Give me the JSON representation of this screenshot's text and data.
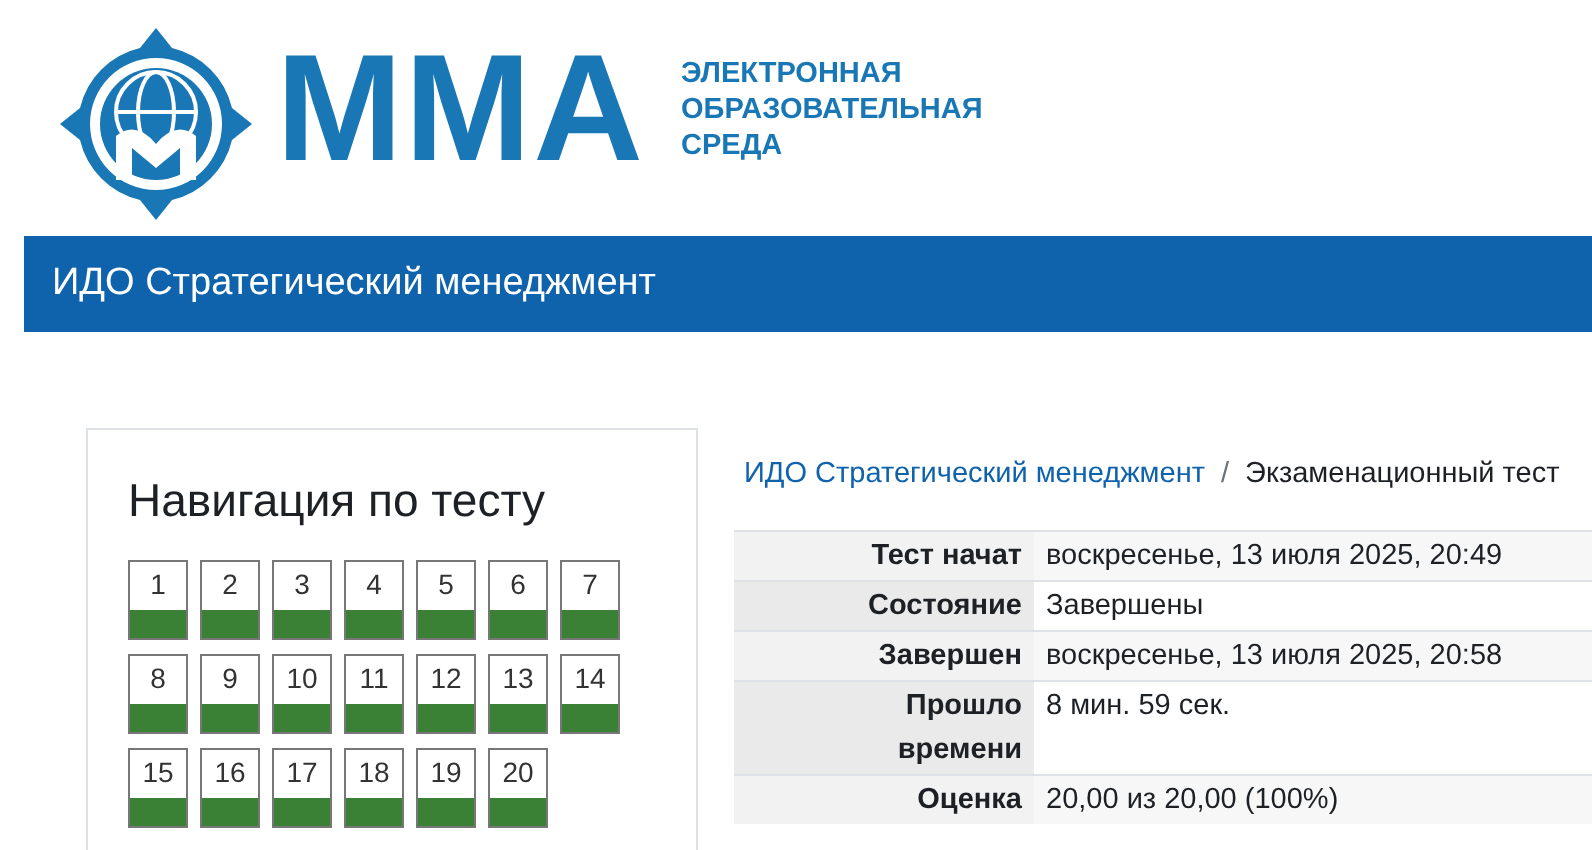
{
  "logo": {
    "wordmark": "ММА",
    "tagline": [
      "ЭЛЕКТРОННАЯ",
      "ОБРАЗОВАТЕЛЬНАЯ",
      "СРЕДА"
    ]
  },
  "header": {
    "title": "ИДО Стратегический менеджмент"
  },
  "quiz_navigation": {
    "title": "Навигация по тесту",
    "questions": [
      {
        "label": "1",
        "answered": true
      },
      {
        "label": "2",
        "answered": true
      },
      {
        "label": "3",
        "answered": true
      },
      {
        "label": "4",
        "answered": true
      },
      {
        "label": "5",
        "answered": true
      },
      {
        "label": "6",
        "answered": true
      },
      {
        "label": "7",
        "answered": true
      },
      {
        "label": "8",
        "answered": true
      },
      {
        "label": "9",
        "answered": true
      },
      {
        "label": "10",
        "answered": true
      },
      {
        "label": "11",
        "answered": true
      },
      {
        "label": "12",
        "answered": true
      },
      {
        "label": "13",
        "answered": true
      },
      {
        "label": "14",
        "answered": true
      },
      {
        "label": "15",
        "answered": true
      },
      {
        "label": "16",
        "answered": true
      },
      {
        "label": "17",
        "answered": true
      },
      {
        "label": "18",
        "answered": true
      },
      {
        "label": "19",
        "answered": true
      },
      {
        "label": "20",
        "answered": true
      }
    ]
  },
  "breadcrumb_separator": "/",
  "breadcrumb": [
    "ИДО Стратегический менеджмент",
    "Экзаменационный тест"
  ],
  "summary": [
    {
      "label": "Тест начат",
      "value": "воскресенье, 13 июля 2025, 20:49"
    },
    {
      "label": "Состояние",
      "value": "Завершены"
    },
    {
      "label": "Завершен",
      "value": "воскресенье, 13 июля 2025, 20:58"
    },
    {
      "label": "Прошло времени",
      "value": "8 мин. 59 сек."
    },
    {
      "label": "Оценка",
      "value": "20,00 из 20,00 (100%)"
    }
  ]
}
